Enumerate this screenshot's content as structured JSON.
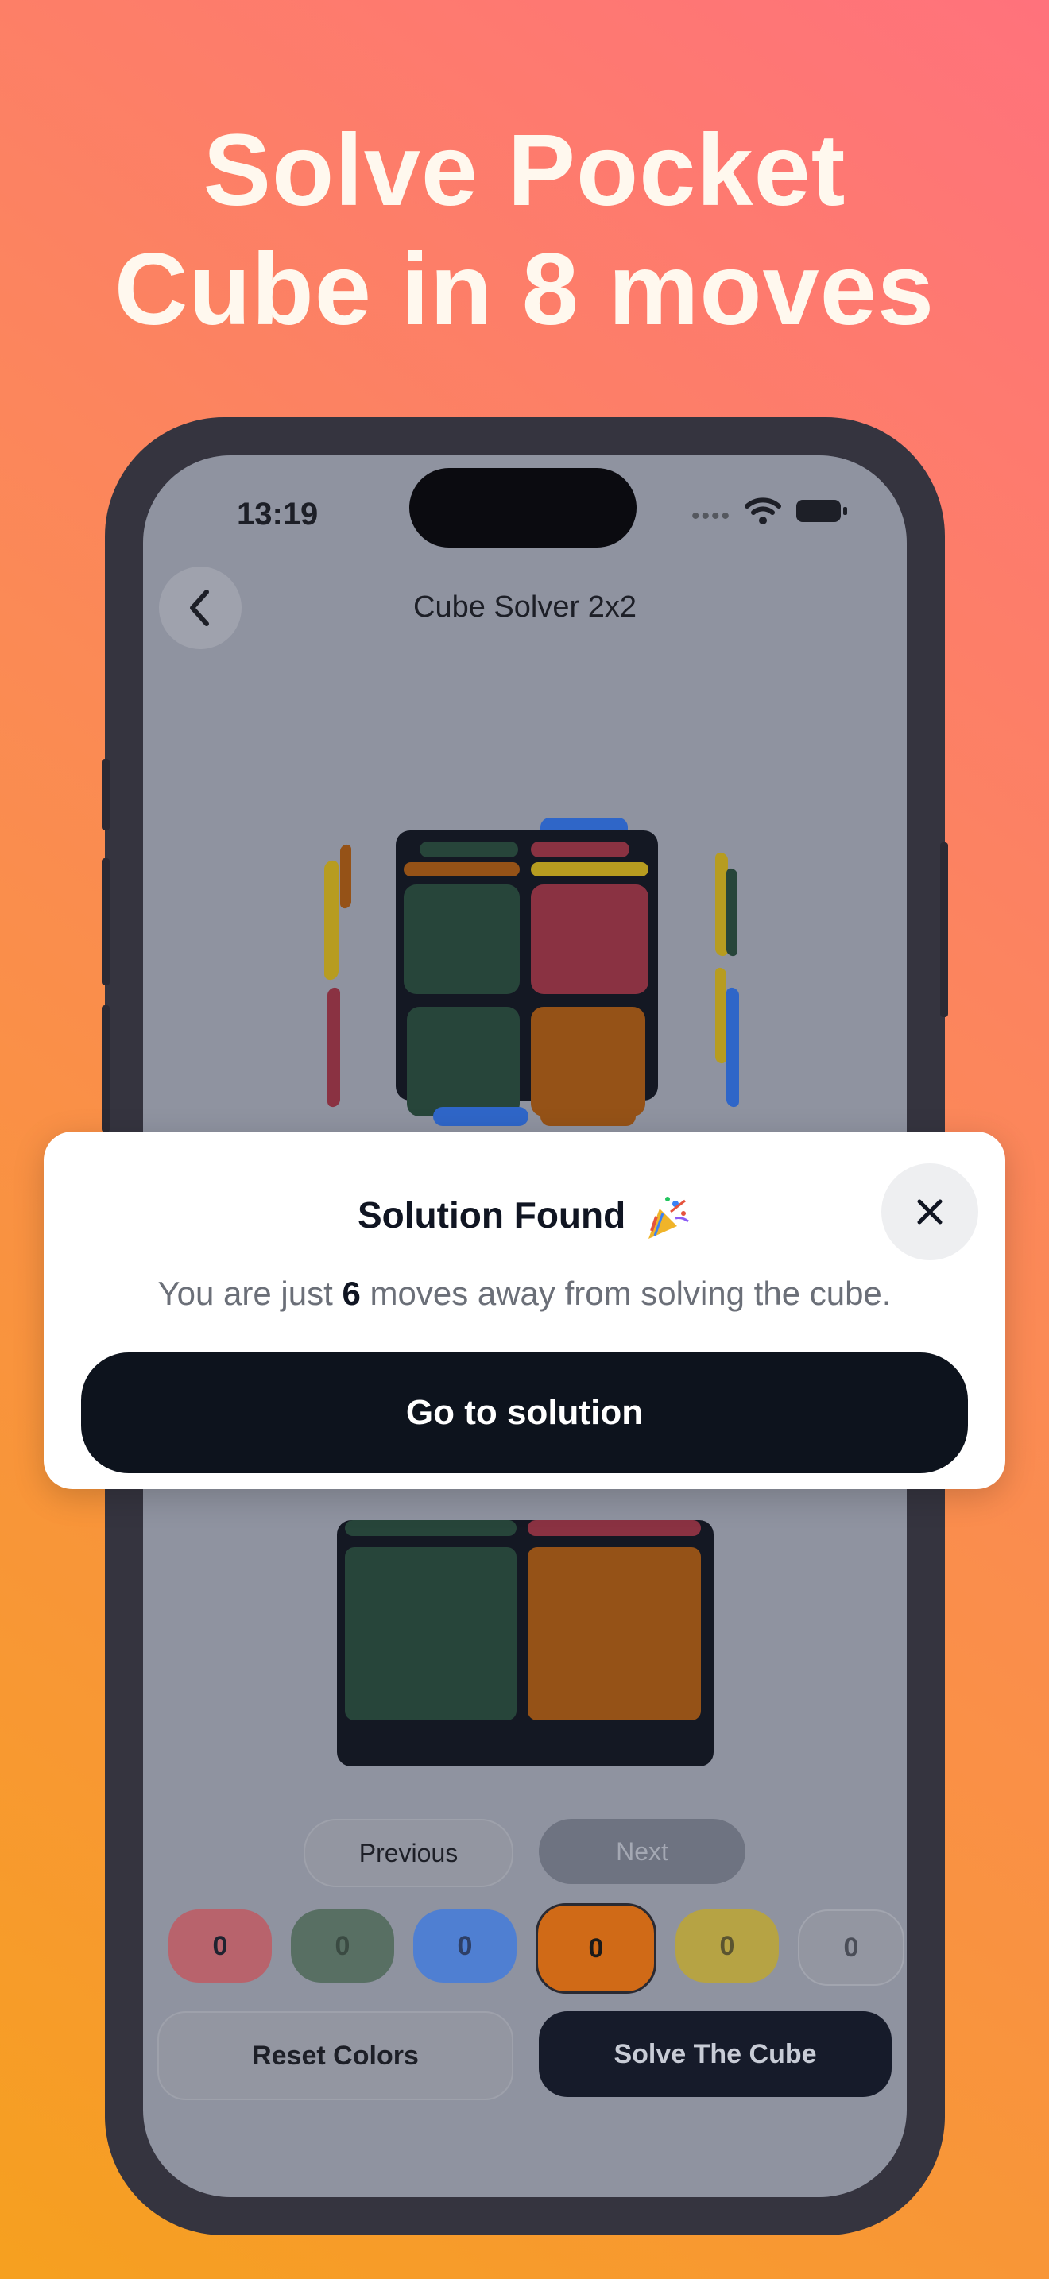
{
  "headline": {
    "line1": "Solve Pocket",
    "line2": "Cube in 8 moves"
  },
  "status_bar": {
    "time": "13:19"
  },
  "nav": {
    "title": "Cube Solver 2x2",
    "back_icon": "chevron-left-icon"
  },
  "pager": {
    "previous_label": "Previous",
    "next_label": "Next"
  },
  "color_counts": [
    {
      "color": "#b8636c",
      "count": "0"
    },
    {
      "color": "#586f63",
      "count": "0"
    },
    {
      "color": "#4f7fd2",
      "count": "0"
    },
    {
      "color": "#d06a17",
      "count": "0"
    },
    {
      "color": "#b6a344",
      "count": "0"
    },
    {
      "color": "#9396a1",
      "count": "0"
    }
  ],
  "actions": {
    "reset_label": "Reset Colors",
    "solve_label": "Solve The Cube"
  },
  "modal": {
    "title": "Solution Found",
    "title_icon": "party-popper-icon",
    "message_before": "You are just ",
    "moves": "6",
    "message_after": " moves away from solving the cube.",
    "button_label": "Go to solution",
    "close_icon": "close-icon"
  },
  "colors": {
    "green": "#27453a",
    "red": "#8a3242",
    "orange": "#955217",
    "blue": "#2f66c8",
    "yellow": "#b79c20"
  }
}
